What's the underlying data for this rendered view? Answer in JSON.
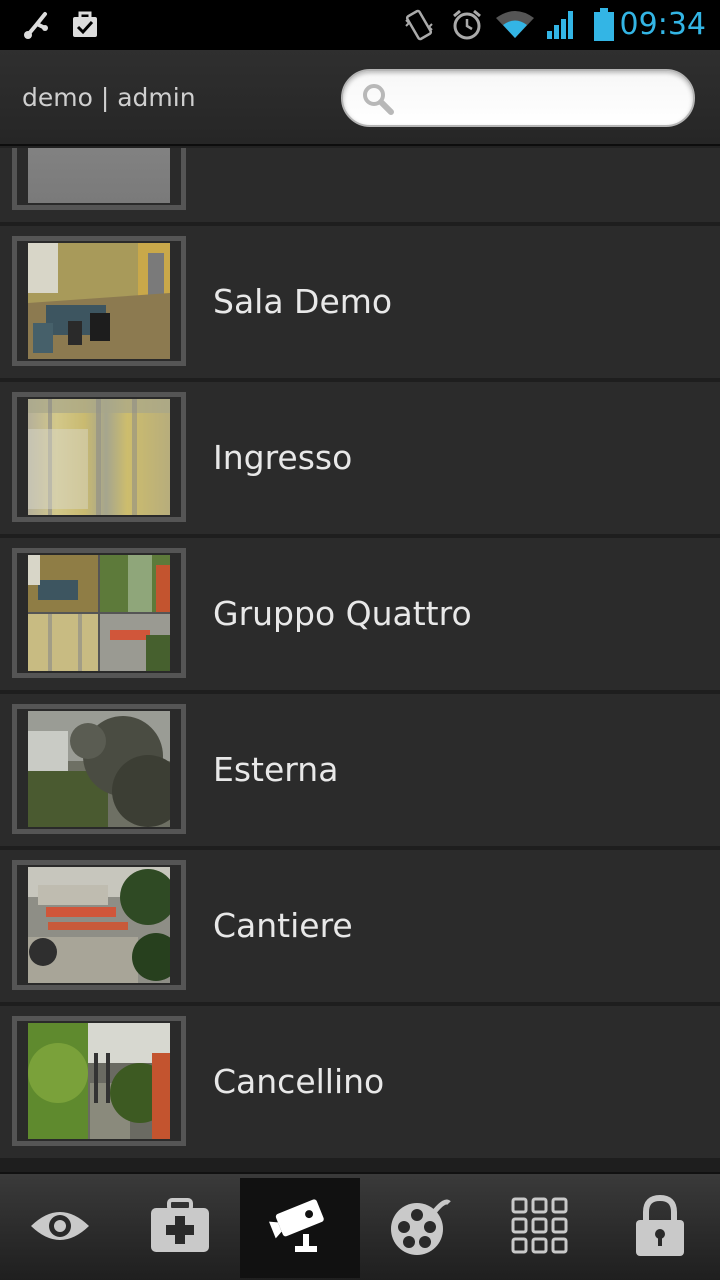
{
  "status_bar": {
    "time": "09:34",
    "icons": [
      "usb-debug-icon",
      "task-check-icon",
      "vibrate-icon",
      "alarm-icon",
      "wifi-icon",
      "signal-icon",
      "battery-icon"
    ]
  },
  "header": {
    "user_label": "demo | admin",
    "search": {
      "value": "",
      "placeholder": ""
    }
  },
  "cameras": [
    {
      "label": ""
    },
    {
      "label": "Sala Demo"
    },
    {
      "label": "Ingresso"
    },
    {
      "label": "Gruppo Quattro"
    },
    {
      "label": "Esterna"
    },
    {
      "label": "Cantiere"
    },
    {
      "label": "Cancellino"
    }
  ],
  "bottom_nav": {
    "tabs": [
      {
        "icon": "eye-icon",
        "active": false
      },
      {
        "icon": "medical-kit-icon",
        "active": false
      },
      {
        "icon": "security-camera-icon",
        "active": true
      },
      {
        "icon": "film-reel-icon",
        "active": false
      },
      {
        "icon": "grid-icon",
        "active": false
      },
      {
        "icon": "lock-icon",
        "active": false
      }
    ]
  },
  "colors": {
    "accent_time": "#33b5e5",
    "background": "#222222",
    "row_background": "#2b2b2b"
  }
}
